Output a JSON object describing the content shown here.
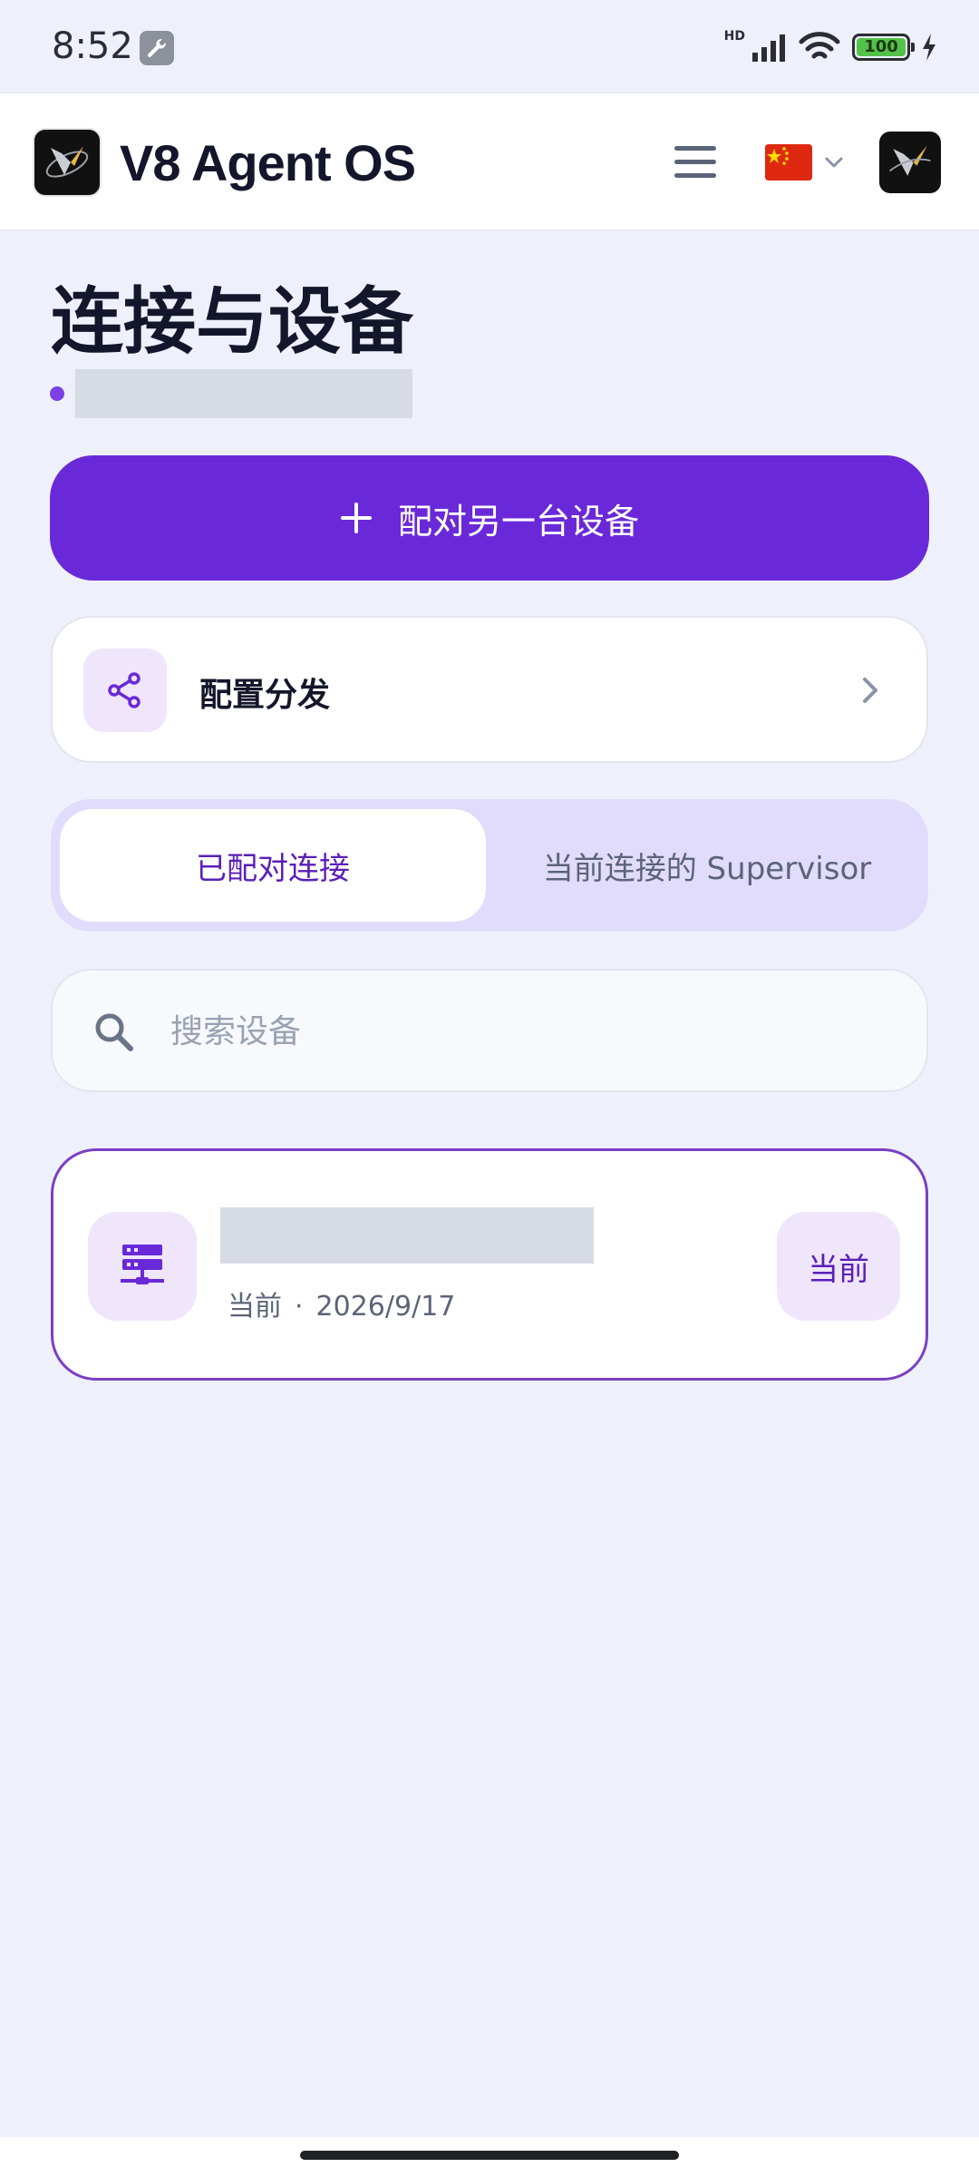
{
  "status_bar": {
    "time": "8:52",
    "network_label": "HD",
    "battery_level": "100"
  },
  "header": {
    "app_title": "V8 Agent OS"
  },
  "page": {
    "title": "连接与设备"
  },
  "actions": {
    "pair_label": "配对另一台设备",
    "config_label": "配置分发"
  },
  "tabs": [
    {
      "label": "已配对连接",
      "active": true
    },
    {
      "label": "当前连接的 Supervisor",
      "active": false
    }
  ],
  "search": {
    "placeholder": "搜索设备"
  },
  "devices": [
    {
      "status": "当前",
      "date": "2026/9/17",
      "badge": "当前"
    }
  ],
  "colors": {
    "accent": "#6a29d8",
    "accent_light": "#efe6fc",
    "background": "#eef1fc"
  }
}
